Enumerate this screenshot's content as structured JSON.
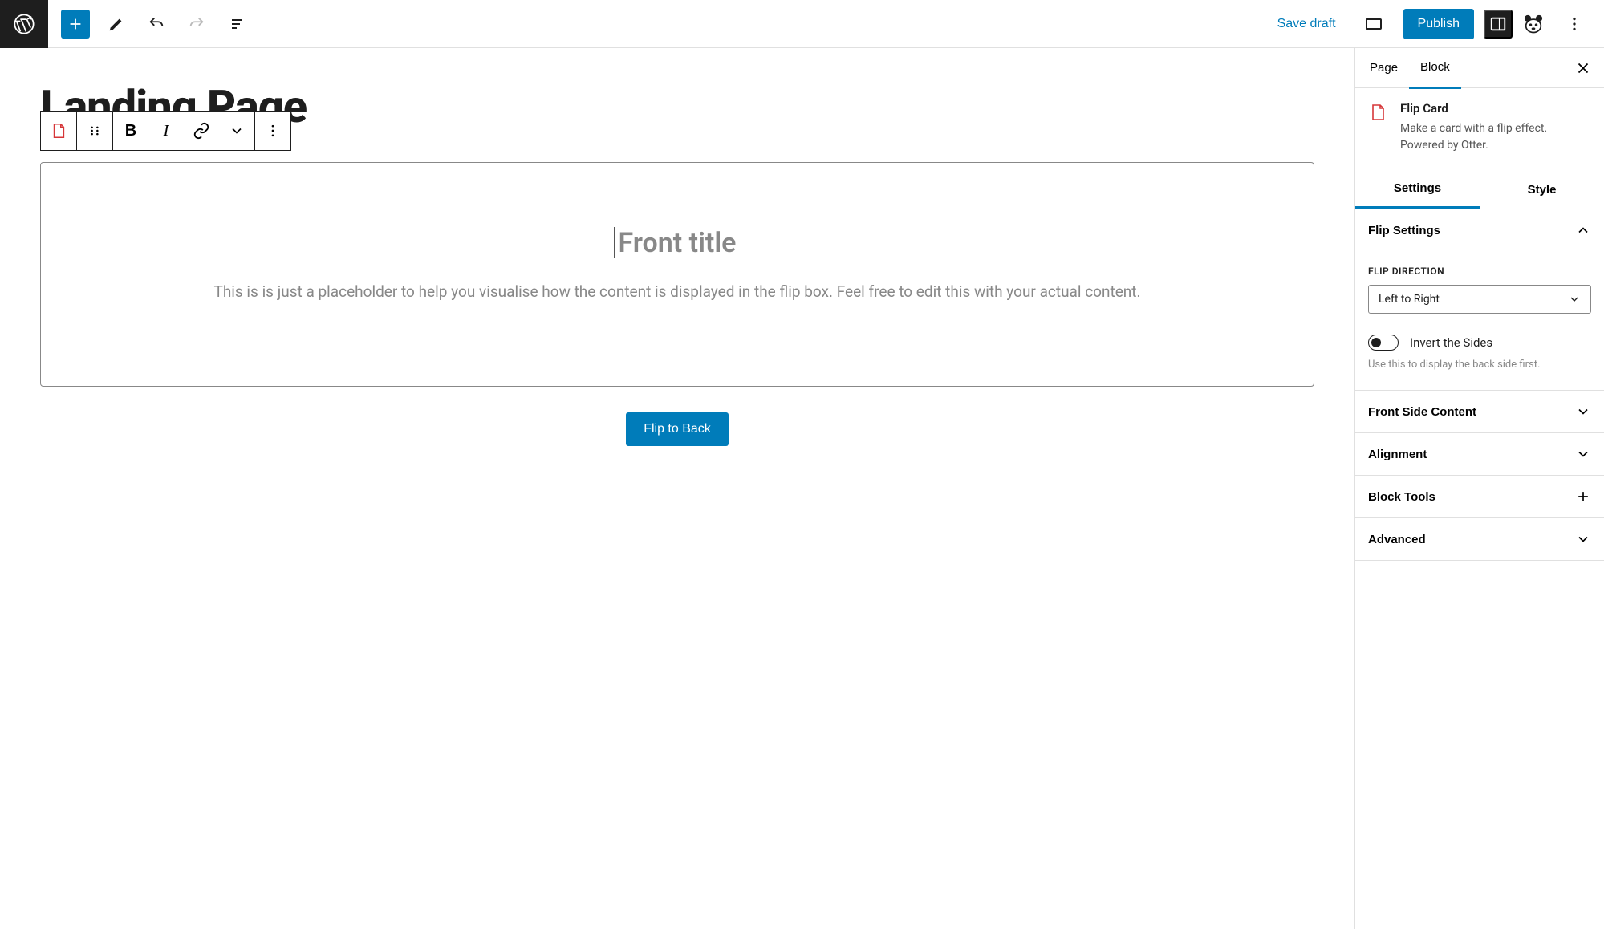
{
  "topbar": {
    "save_draft": "Save draft",
    "publish": "Publish"
  },
  "editor": {
    "page_title": "Landing Page",
    "front_title": "Front title",
    "front_desc": "This is is just a placeholder to help you visualise how the content is displayed in the flip box. Feel free to edit this with your actual content.",
    "flip_button": "Flip to Back"
  },
  "sidebar": {
    "tabs": {
      "page": "Page",
      "block": "Block"
    },
    "block_card": {
      "title": "Flip Card",
      "desc": "Make a card with a flip effect. Powered by Otter."
    },
    "sub_tabs": {
      "settings": "Settings",
      "style": "Style"
    },
    "flip_settings": {
      "title": "Flip Settings",
      "direction_label": "FLIP DIRECTION",
      "direction_value": "Left to Right",
      "invert_label": "Invert the Sides",
      "invert_help": "Use this to display the back side first."
    },
    "panels": {
      "front_side": "Front Side Content",
      "alignment": "Alignment",
      "block_tools": "Block Tools",
      "advanced": "Advanced"
    }
  }
}
